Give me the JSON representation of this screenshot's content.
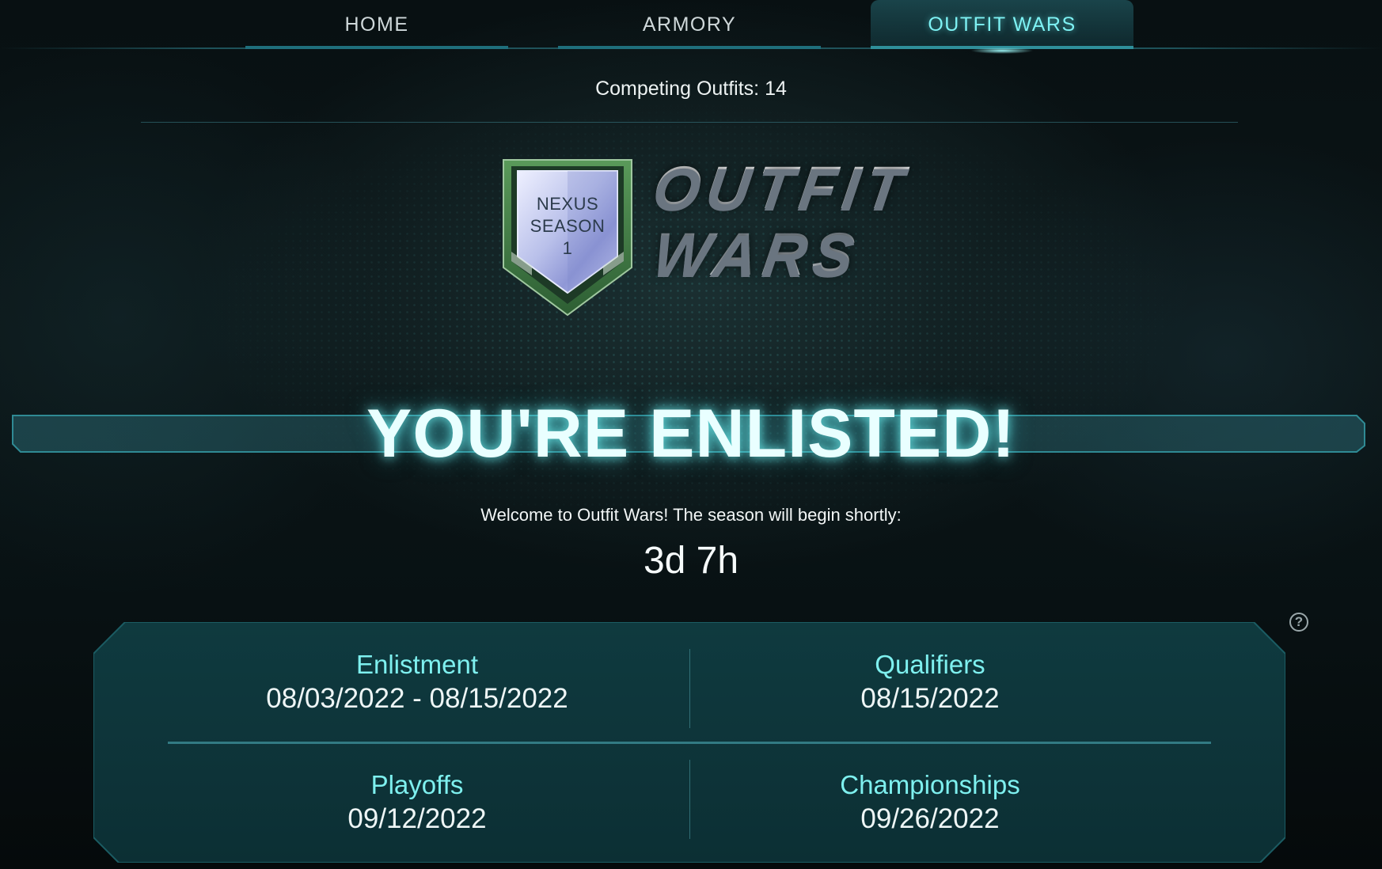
{
  "nav": {
    "tabs": [
      {
        "label": "HOME",
        "active": false
      },
      {
        "label": "ARMORY",
        "active": false
      },
      {
        "label": "OUTFIT WARS",
        "active": true
      }
    ]
  },
  "header": {
    "competing": "Competing Outfits: 14"
  },
  "logo": {
    "badge_line1": "NEXUS",
    "badge_line2": "SEASON",
    "badge_line3": "1",
    "word1": "OUTFIT",
    "word2": "WARS"
  },
  "status": {
    "headline": "YOU'RE ENLISTED!",
    "welcome": "Welcome to Outfit Wars! The season will begin shortly:",
    "countdown": "3d 7h"
  },
  "schedule": {
    "enlistment": {
      "label": "Enlistment",
      "value": "08/03/2022 - 08/15/2022"
    },
    "qualifiers": {
      "label": "Qualifiers",
      "value": "08/15/2022"
    },
    "playoffs": {
      "label": "Playoffs",
      "value": "09/12/2022"
    },
    "championships": {
      "label": "Championships",
      "value": "09/26/2022"
    }
  },
  "help_icon_glyph": "?",
  "colors": {
    "accent": "#7ef0ef",
    "panel": "#0f3b40",
    "shield_green": "#3f7a3f"
  }
}
